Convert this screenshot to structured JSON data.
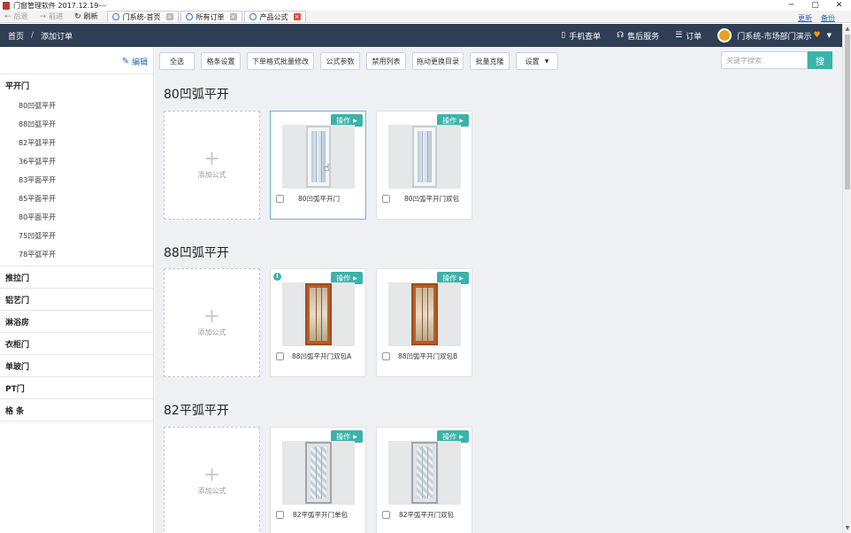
{
  "window": {
    "title": "门窗管理软件 2017.12.19---",
    "controls": [
      "─",
      "▢",
      "✕"
    ]
  },
  "nav": {
    "back": "后退",
    "forward": "前进",
    "refresh": "刷新",
    "tabs": [
      "门系统-首页",
      "所有订单",
      "产品公式"
    ],
    "right_links": [
      "更新",
      "备份"
    ]
  },
  "header": {
    "breadcrumb": [
      "首页",
      "/",
      "添加订单"
    ],
    "links": [
      "手机查单",
      "售后服务",
      "订单"
    ],
    "user": "门系统-市场部门演示"
  },
  "sidebar": {
    "edit": "编辑",
    "open_category": "平开门",
    "subitems": [
      "80凹弧平开",
      "88凹弧平开",
      "82平弧平开",
      "36平弧平开",
      "83平面平开",
      "85平面平开",
      "80平面平开",
      "75凹弧平开",
      "78平弧平开"
    ],
    "categories": [
      "推拉门",
      "铝艺门",
      "淋浴房",
      "衣柜门",
      "单玻门",
      "PT门",
      "格 条"
    ]
  },
  "toolbar": {
    "buttons": [
      "全选",
      "格条设置",
      "下单格式批量修改",
      "公式参数",
      "禁用列表",
      "拖动更换目录",
      "批量克隆",
      "设置"
    ],
    "search_placeholder": "关键字搜索",
    "search_button": "搜"
  },
  "sections": [
    {
      "title": "80凹弧平开",
      "add_label": "添加公式",
      "op_label": "操作",
      "cards": [
        "80凹弧平开门",
        "80凹弧平开门双包"
      ]
    },
    {
      "title": "88凹弧平开",
      "add_label": "添加公式",
      "op_label": "操作",
      "cards": [
        "88凹弧平开门双包A",
        "88凹弧平开门双包B"
      ]
    },
    {
      "title": "82平弧平开",
      "add_label": "添加公式",
      "op_label": "操作",
      "cards": [
        "82平弧平开门单包",
        "82平弧平开门双包"
      ]
    }
  ]
}
